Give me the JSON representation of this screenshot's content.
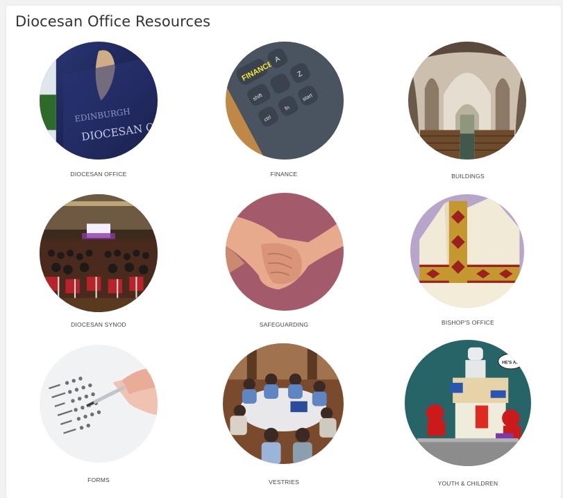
{
  "title": "Diocesan Office Resources",
  "tiles": [
    {
      "label": "DIOCESAN OFFICE",
      "image": "office-sign-photo"
    },
    {
      "label": "FINANCE",
      "image": "keyboard-finance-key-photo",
      "key_text": "FINANCE",
      "keys": [
        "shift",
        "ctrl",
        "fn",
        "start",
        "A",
        "Z"
      ]
    },
    {
      "label": "BUILDINGS",
      "image": "church-interior-photo"
    },
    {
      "label": "DIOCESAN SYNOD",
      "image": "synod-assembly-photo"
    },
    {
      "label": "SAFEGUARDING",
      "image": "holding-hands-photo"
    },
    {
      "label": "BISHOP'S OFFICE",
      "image": "mitre-photo"
    },
    {
      "label": "FORMS",
      "image": "filling-form-photo"
    },
    {
      "label": "VESTRIES",
      "image": "vestry-meeting-photo"
    },
    {
      "label": "YOUTH & CHILDREN",
      "image": "lego-scene-photo",
      "bubble_text": "HE'S ALIVE!"
    }
  ]
}
